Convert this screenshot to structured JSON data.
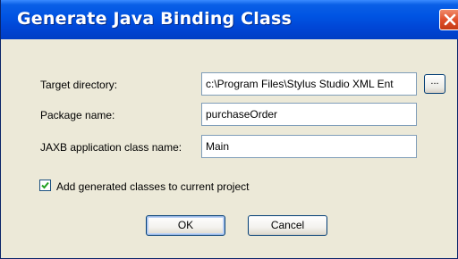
{
  "window": {
    "title": "Generate Java Binding Class"
  },
  "form": {
    "target_directory": {
      "label": "Target directory:",
      "value": "c:\\Program Files\\Stylus Studio XML Ent",
      "browse_label": "..."
    },
    "package_name": {
      "label": "Package name:",
      "value": "purchaseOrder"
    },
    "jaxb_class_name": {
      "label": "JAXB application class name:",
      "value": "Main"
    },
    "add_to_project": {
      "label": "Add generated classes to current project",
      "checked": true
    }
  },
  "buttons": {
    "ok_label": "OK",
    "cancel_label": "Cancel"
  },
  "colors": {
    "titlebar": "#0054e3",
    "close_button": "#e0502c",
    "dialog_background": "#ece9d8",
    "checkmark": "#21a121"
  }
}
